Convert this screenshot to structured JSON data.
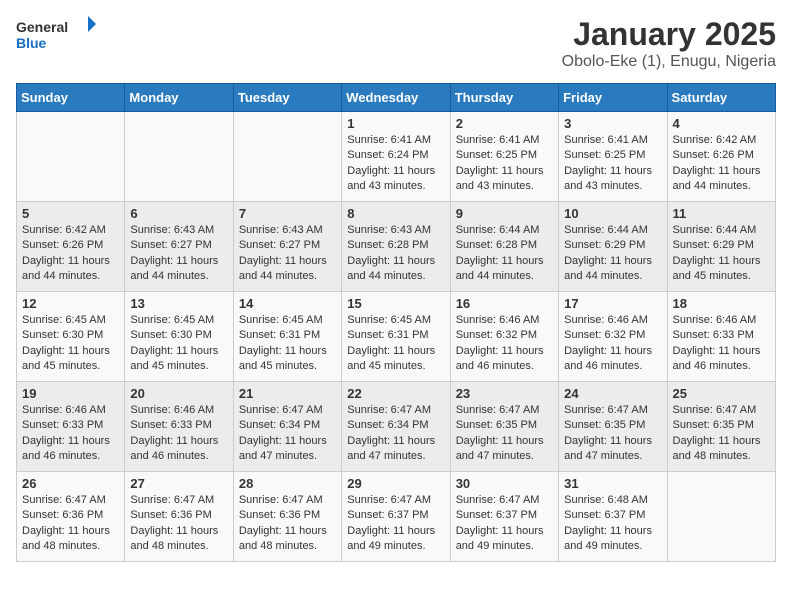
{
  "header": {
    "logo_general": "General",
    "logo_blue": "Blue",
    "main_title": "January 2025",
    "subtitle": "Obolo-Eke (1), Enugu, Nigeria"
  },
  "days_of_week": [
    "Sunday",
    "Monday",
    "Tuesday",
    "Wednesday",
    "Thursday",
    "Friday",
    "Saturday"
  ],
  "weeks": [
    [
      {
        "day": "",
        "info": ""
      },
      {
        "day": "",
        "info": ""
      },
      {
        "day": "",
        "info": ""
      },
      {
        "day": "1",
        "info": "Sunrise: 6:41 AM\nSunset: 6:24 PM\nDaylight: 11 hours and 43 minutes."
      },
      {
        "day": "2",
        "info": "Sunrise: 6:41 AM\nSunset: 6:25 PM\nDaylight: 11 hours and 43 minutes."
      },
      {
        "day": "3",
        "info": "Sunrise: 6:41 AM\nSunset: 6:25 PM\nDaylight: 11 hours and 43 minutes."
      },
      {
        "day": "4",
        "info": "Sunrise: 6:42 AM\nSunset: 6:26 PM\nDaylight: 11 hours and 44 minutes."
      }
    ],
    [
      {
        "day": "5",
        "info": "Sunrise: 6:42 AM\nSunset: 6:26 PM\nDaylight: 11 hours and 44 minutes."
      },
      {
        "day": "6",
        "info": "Sunrise: 6:43 AM\nSunset: 6:27 PM\nDaylight: 11 hours and 44 minutes."
      },
      {
        "day": "7",
        "info": "Sunrise: 6:43 AM\nSunset: 6:27 PM\nDaylight: 11 hours and 44 minutes."
      },
      {
        "day": "8",
        "info": "Sunrise: 6:43 AM\nSunset: 6:28 PM\nDaylight: 11 hours and 44 minutes."
      },
      {
        "day": "9",
        "info": "Sunrise: 6:44 AM\nSunset: 6:28 PM\nDaylight: 11 hours and 44 minutes."
      },
      {
        "day": "10",
        "info": "Sunrise: 6:44 AM\nSunset: 6:29 PM\nDaylight: 11 hours and 44 minutes."
      },
      {
        "day": "11",
        "info": "Sunrise: 6:44 AM\nSunset: 6:29 PM\nDaylight: 11 hours and 45 minutes."
      }
    ],
    [
      {
        "day": "12",
        "info": "Sunrise: 6:45 AM\nSunset: 6:30 PM\nDaylight: 11 hours and 45 minutes."
      },
      {
        "day": "13",
        "info": "Sunrise: 6:45 AM\nSunset: 6:30 PM\nDaylight: 11 hours and 45 minutes."
      },
      {
        "day": "14",
        "info": "Sunrise: 6:45 AM\nSunset: 6:31 PM\nDaylight: 11 hours and 45 minutes."
      },
      {
        "day": "15",
        "info": "Sunrise: 6:45 AM\nSunset: 6:31 PM\nDaylight: 11 hours and 45 minutes."
      },
      {
        "day": "16",
        "info": "Sunrise: 6:46 AM\nSunset: 6:32 PM\nDaylight: 11 hours and 46 minutes."
      },
      {
        "day": "17",
        "info": "Sunrise: 6:46 AM\nSunset: 6:32 PM\nDaylight: 11 hours and 46 minutes."
      },
      {
        "day": "18",
        "info": "Sunrise: 6:46 AM\nSunset: 6:33 PM\nDaylight: 11 hours and 46 minutes."
      }
    ],
    [
      {
        "day": "19",
        "info": "Sunrise: 6:46 AM\nSunset: 6:33 PM\nDaylight: 11 hours and 46 minutes."
      },
      {
        "day": "20",
        "info": "Sunrise: 6:46 AM\nSunset: 6:33 PM\nDaylight: 11 hours and 46 minutes."
      },
      {
        "day": "21",
        "info": "Sunrise: 6:47 AM\nSunset: 6:34 PM\nDaylight: 11 hours and 47 minutes."
      },
      {
        "day": "22",
        "info": "Sunrise: 6:47 AM\nSunset: 6:34 PM\nDaylight: 11 hours and 47 minutes."
      },
      {
        "day": "23",
        "info": "Sunrise: 6:47 AM\nSunset: 6:35 PM\nDaylight: 11 hours and 47 minutes."
      },
      {
        "day": "24",
        "info": "Sunrise: 6:47 AM\nSunset: 6:35 PM\nDaylight: 11 hours and 47 minutes."
      },
      {
        "day": "25",
        "info": "Sunrise: 6:47 AM\nSunset: 6:35 PM\nDaylight: 11 hours and 48 minutes."
      }
    ],
    [
      {
        "day": "26",
        "info": "Sunrise: 6:47 AM\nSunset: 6:36 PM\nDaylight: 11 hours and 48 minutes."
      },
      {
        "day": "27",
        "info": "Sunrise: 6:47 AM\nSunset: 6:36 PM\nDaylight: 11 hours and 48 minutes."
      },
      {
        "day": "28",
        "info": "Sunrise: 6:47 AM\nSunset: 6:36 PM\nDaylight: 11 hours and 48 minutes."
      },
      {
        "day": "29",
        "info": "Sunrise: 6:47 AM\nSunset: 6:37 PM\nDaylight: 11 hours and 49 minutes."
      },
      {
        "day": "30",
        "info": "Sunrise: 6:47 AM\nSunset: 6:37 PM\nDaylight: 11 hours and 49 minutes."
      },
      {
        "day": "31",
        "info": "Sunrise: 6:48 AM\nSunset: 6:37 PM\nDaylight: 11 hours and 49 minutes."
      },
      {
        "day": "",
        "info": ""
      }
    ]
  ]
}
